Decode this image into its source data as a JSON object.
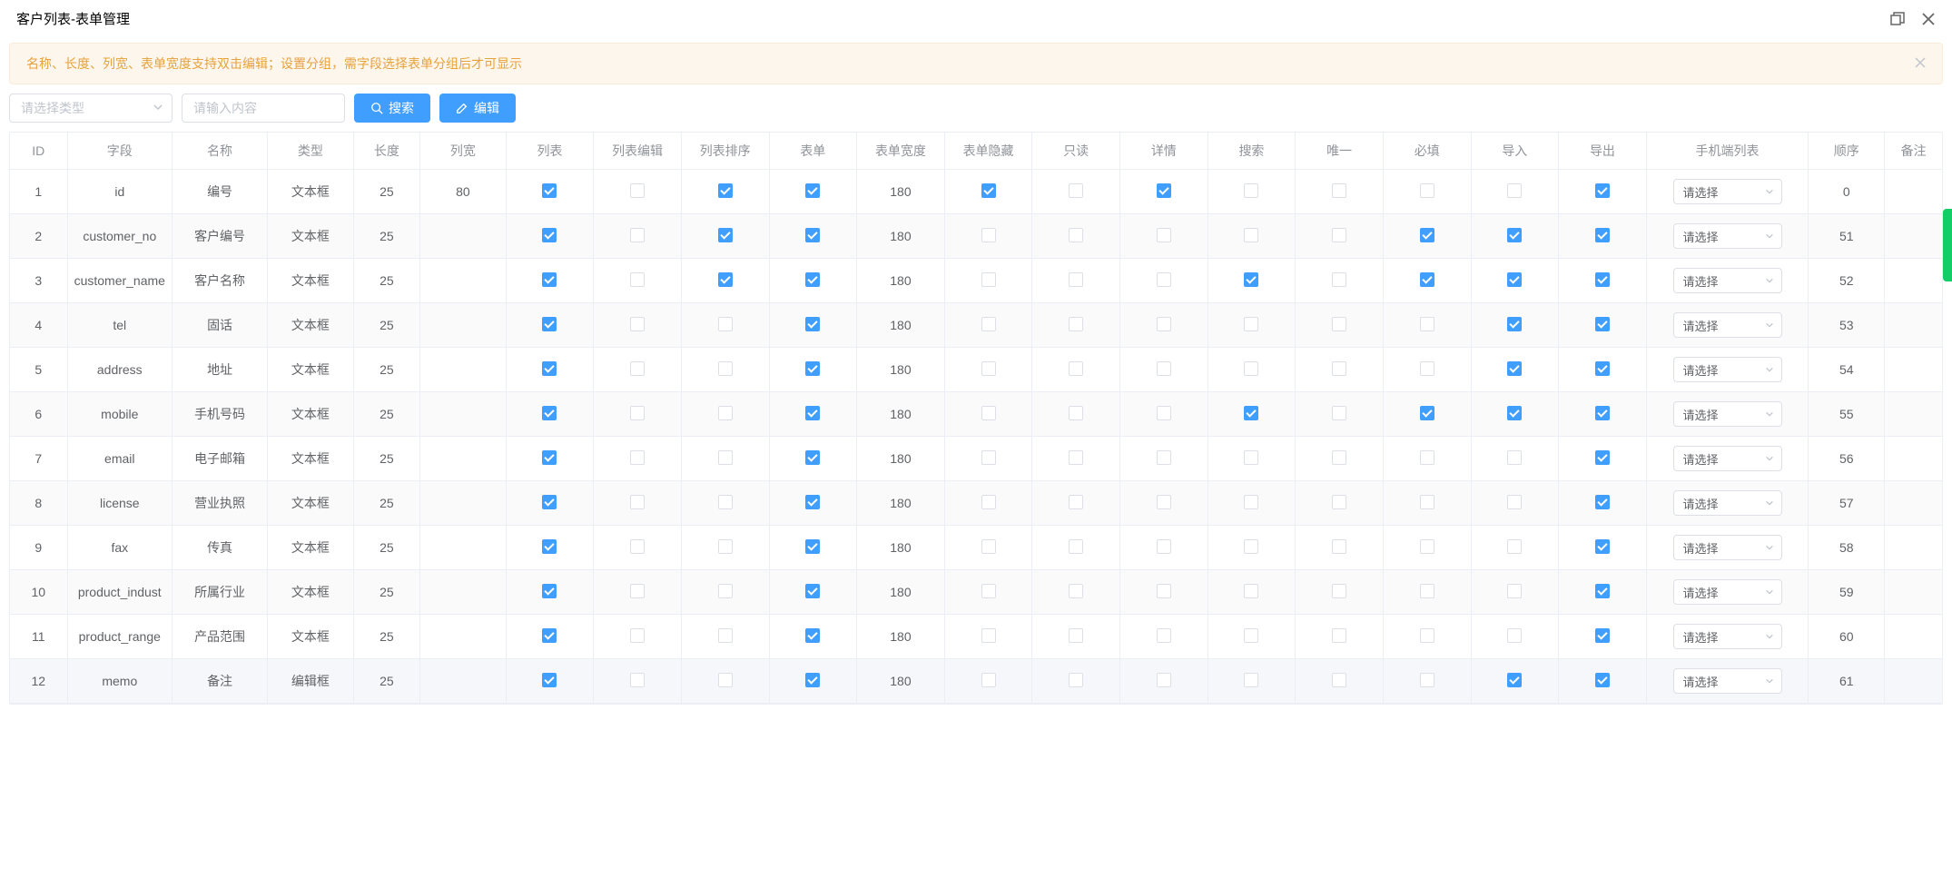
{
  "header": {
    "title": "客户列表-表单管理"
  },
  "alert": {
    "text": "名称、长度、列宽、表单宽度支持双击编辑；设置分组，需字段选择表单分组后才可显示"
  },
  "toolbar": {
    "type_placeholder": "请选择类型",
    "search_placeholder": "请输入内容",
    "search_label": "搜索",
    "edit_label": "编辑"
  },
  "table": {
    "columns": [
      "ID",
      "字段",
      "名称",
      "类型",
      "长度",
      "列宽",
      "列表",
      "列表编辑",
      "列表排序",
      "表单",
      "表单宽度",
      "表单隐藏",
      "只读",
      "详情",
      "搜索",
      "唯一",
      "必填",
      "导入",
      "导出",
      "手机端列表",
      "顺序",
      "备注"
    ],
    "mobile_placeholder": "请选择",
    "rows": [
      {
        "id": "1",
        "field": "id",
        "name": "编号",
        "type": "文本框",
        "len": "25",
        "cw": "80",
        "list": true,
        "ledit": false,
        "lsort": true,
        "form": true,
        "fw": "180",
        "fhide": true,
        "ro": false,
        "detail": true,
        "search": false,
        "uniq": false,
        "req": false,
        "imp": false,
        "exp": true,
        "order": "0",
        "remark": ""
      },
      {
        "id": "2",
        "field": "customer_no",
        "name": "客户编号",
        "type": "文本框",
        "len": "25",
        "cw": "",
        "list": true,
        "ledit": false,
        "lsort": true,
        "form": true,
        "fw": "180",
        "fhide": false,
        "ro": false,
        "detail": false,
        "search": false,
        "uniq": false,
        "req": true,
        "imp": true,
        "exp": true,
        "order": "51",
        "remark": ""
      },
      {
        "id": "3",
        "field": "customer_name",
        "name": "客户名称",
        "type": "文本框",
        "len": "25",
        "cw": "",
        "list": true,
        "ledit": false,
        "lsort": true,
        "form": true,
        "fw": "180",
        "fhide": false,
        "ro": false,
        "detail": false,
        "search": true,
        "uniq": false,
        "req": true,
        "imp": true,
        "exp": true,
        "order": "52",
        "remark": ""
      },
      {
        "id": "4",
        "field": "tel",
        "name": "固话",
        "type": "文本框",
        "len": "25",
        "cw": "",
        "list": true,
        "ledit": false,
        "lsort": false,
        "form": true,
        "fw": "180",
        "fhide": false,
        "ro": false,
        "detail": false,
        "search": false,
        "uniq": false,
        "req": false,
        "imp": true,
        "exp": true,
        "order": "53",
        "remark": ""
      },
      {
        "id": "5",
        "field": "address",
        "name": "地址",
        "type": "文本框",
        "len": "25",
        "cw": "",
        "list": true,
        "ledit": false,
        "lsort": false,
        "form": true,
        "fw": "180",
        "fhide": false,
        "ro": false,
        "detail": false,
        "search": false,
        "uniq": false,
        "req": false,
        "imp": true,
        "exp": true,
        "order": "54",
        "remark": ""
      },
      {
        "id": "6",
        "field": "mobile",
        "name": "手机号码",
        "type": "文本框",
        "len": "25",
        "cw": "",
        "list": true,
        "ledit": false,
        "lsort": false,
        "form": true,
        "fw": "180",
        "fhide": false,
        "ro": false,
        "detail": false,
        "search": true,
        "uniq": false,
        "req": true,
        "imp": true,
        "exp": true,
        "order": "55",
        "remark": ""
      },
      {
        "id": "7",
        "field": "email",
        "name": "电子邮箱",
        "type": "文本框",
        "len": "25",
        "cw": "",
        "list": true,
        "ledit": false,
        "lsort": false,
        "form": true,
        "fw": "180",
        "fhide": false,
        "ro": false,
        "detail": false,
        "search": false,
        "uniq": false,
        "req": false,
        "imp": false,
        "exp": true,
        "order": "56",
        "remark": ""
      },
      {
        "id": "8",
        "field": "license",
        "name": "营业执照",
        "type": "文本框",
        "len": "25",
        "cw": "",
        "list": true,
        "ledit": false,
        "lsort": false,
        "form": true,
        "fw": "180",
        "fhide": false,
        "ro": false,
        "detail": false,
        "search": false,
        "uniq": false,
        "req": false,
        "imp": false,
        "exp": true,
        "order": "57",
        "remark": ""
      },
      {
        "id": "9",
        "field": "fax",
        "name": "传真",
        "type": "文本框",
        "len": "25",
        "cw": "",
        "list": true,
        "ledit": false,
        "lsort": false,
        "form": true,
        "fw": "180",
        "fhide": false,
        "ro": false,
        "detail": false,
        "search": false,
        "uniq": false,
        "req": false,
        "imp": false,
        "exp": true,
        "order": "58",
        "remark": ""
      },
      {
        "id": "10",
        "field": "product_indust",
        "name": "所属行业",
        "type": "文本框",
        "len": "25",
        "cw": "",
        "list": true,
        "ledit": false,
        "lsort": false,
        "form": true,
        "fw": "180",
        "fhide": false,
        "ro": false,
        "detail": false,
        "search": false,
        "uniq": false,
        "req": false,
        "imp": false,
        "exp": true,
        "order": "59",
        "remark": ""
      },
      {
        "id": "11",
        "field": "product_range",
        "name": "产品范围",
        "type": "文本框",
        "len": "25",
        "cw": "",
        "list": true,
        "ledit": false,
        "lsort": false,
        "form": true,
        "fw": "180",
        "fhide": false,
        "ro": false,
        "detail": false,
        "search": false,
        "uniq": false,
        "req": false,
        "imp": false,
        "exp": true,
        "order": "60",
        "remark": ""
      },
      {
        "id": "12",
        "field": "memo",
        "name": "备注",
        "type": "编辑框",
        "len": "25",
        "cw": "",
        "list": true,
        "ledit": false,
        "lsort": false,
        "form": true,
        "fw": "180",
        "fhide": false,
        "ro": false,
        "detail": false,
        "search": false,
        "uniq": false,
        "req": false,
        "imp": true,
        "exp": true,
        "order": "61",
        "remark": "",
        "hover": true
      }
    ]
  }
}
